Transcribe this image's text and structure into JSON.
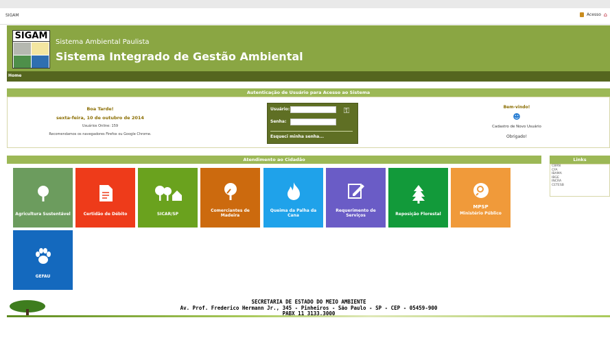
{
  "app_title": "SIGAM",
  "top_right": {
    "access": "Acesso"
  },
  "logo_text": "SIGAM",
  "header": {
    "subtitle": "Sistema Ambiental Paulista",
    "title": "Sistema Integrado de Gestão Ambiental"
  },
  "nav": {
    "home": "Home"
  },
  "auth": {
    "bar_title": "Autenticação de Usuário para Acesso ao Sistema",
    "greeting": "Boa Tarde!",
    "date": "sexta-feira, 10 de outubro de 2014",
    "online": "Usuários Online: 159",
    "browsers": "Recomendamos os navegadores Firefox ou Google Chrome.",
    "user_label": "Usuário:",
    "pass_label": "Senha:",
    "forgot": "Esqueci minha senha...",
    "welcome": "Bem-vindo!",
    "register": "Cadastro de Novo Usuário",
    "thanks": "Obrigado!"
  },
  "atendimento_title": "Atendimento ao Cidadão",
  "links": {
    "title": "Links",
    "items": [
      "CBRN",
      "CFA",
      "IBAMA",
      "IBGE",
      "INCRA",
      "CETESB"
    ]
  },
  "tiles": [
    {
      "label": "Agricultura Sustentável",
      "color": "#6c9c5e",
      "icon": "tree-icon"
    },
    {
      "label": "Certidão de Débito",
      "color": "#ee3b1a",
      "icon": "document-icon"
    },
    {
      "label": "SICAR/SP",
      "color": "#6aa21e",
      "icon": "house-trees-icon"
    },
    {
      "label": "Comerciantes de Madeira",
      "color": "#cc6a0e",
      "icon": "tree-cut-icon"
    },
    {
      "label": "Queima da Palha da Cana",
      "color": "#1fa2ea",
      "icon": "fire-icon"
    },
    {
      "label": "Requerimento de Serviços",
      "color": "#6a5cc6",
      "icon": "edit-icon"
    },
    {
      "label": "Reposição Florestal",
      "color": "#129a3a",
      "icon": "pine-tree-icon"
    },
    {
      "label": "MPSP",
      "label2": "Ministério Público",
      "color": "#f09a3a",
      "icon": "search-icon"
    },
    {
      "label": "GEFAU",
      "color": "#1469be",
      "icon": "paw-icon"
    }
  ],
  "footer": {
    "line1": "SECRETARIA DE ESTADO DO MEIO AMBIENTE",
    "line2": "Av. Prof. Frederico Hermann Jr., 345 - Pinheiros - São Paulo - SP - CEP - 05459-900",
    "line3": "PABX 11 3133.3000"
  }
}
